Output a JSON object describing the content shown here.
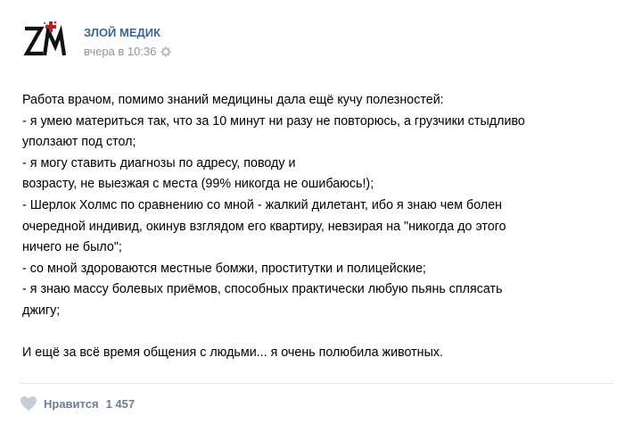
{
  "author": {
    "name": "ЗЛОЙ МЕДИК",
    "avatar_icon": "logo-zm-with-red-cross"
  },
  "meta": {
    "time": "вчера в 10:36",
    "settings_icon": "gear-icon"
  },
  "post": {
    "lines": [
      "Работа врачом, помимо знаний медицины дала ещё кучу полезностей:",
      "- я умею материться так, что за 10 минут ни разу не повторюсь, а грузчики стыдливо",
      "уползают под стол;",
      "- я могу ставить диагнозы по адресу, поводу и",
      "возрасту, не выезжая с места (99% никогда не ошибаюсь!);",
      "- Шерлок Холмс по сравнению со мной - жалкий дилетант, ибо я знаю чем болен",
      "очередной индивид, окинув взглядом его квартиру, невзирая на \"никогда до этого",
      "ничего не было\";",
      "- со мной здороваются местные бомжи, проститутки и полицейские;",
      "- я знаю массу болевых приёмов, способных практически любую пьянь сплясать",
      "джигу;",
      "",
      "И ещё за всё время общения с людьми... я очень полюбила животных."
    ]
  },
  "footer": {
    "like_icon": "heart-icon",
    "like_label": "Нравится",
    "like_count": "1 457"
  },
  "colors": {
    "author": "#42648b",
    "meta": "#939393",
    "like": "#6f7f91",
    "heart": "#c5cdd6",
    "accent_red": "#b8202a"
  }
}
